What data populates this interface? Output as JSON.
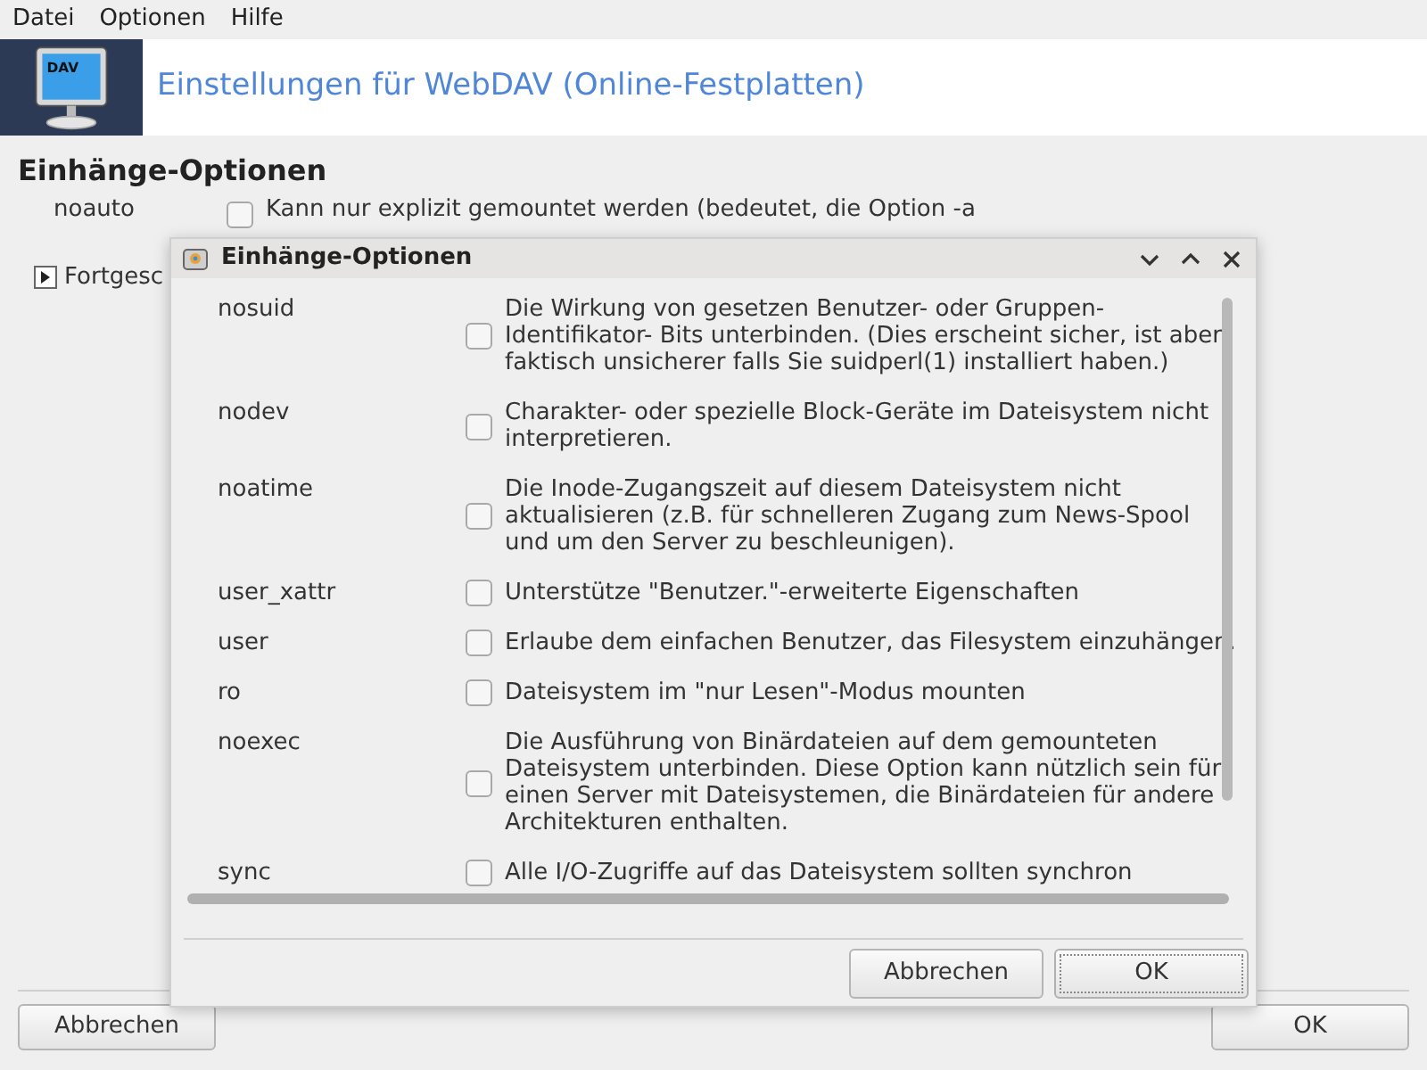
{
  "menu": [
    "Datei",
    "Optionen",
    "Hilfe"
  ],
  "header": {
    "icon_text": "DAV",
    "title": "Einstellungen für WebDAV (Online-Festplatten)"
  },
  "section_title": "Einhänge-Optionen",
  "background_option": {
    "name": "noauto",
    "checked": false,
    "text": "Kann nur explizit gemountet werden (bedeutet, die Option -a"
  },
  "advanced": {
    "label": "Fortgesc",
    "expanded": false
  },
  "buttons": [
    "Abbrechen",
    "OK"
  ],
  "dialog": {
    "title": "Einhänge-Optionen",
    "options": [
      {
        "name": "nosuid",
        "checked": false,
        "text": "Die Wirkung von gesetzen Benutzer- oder Gruppen-Identifikator- Bits unterbinden. (Dies erscheint sicher, ist aber faktisch unsicherer falls Sie suidperl(1) installiert haben.)"
      },
      {
        "name": "nodev",
        "checked": false,
        "text": "Charakter- oder spezielle Block-Geräte im Dateisystem nicht interpretieren."
      },
      {
        "name": "noatime",
        "checked": false,
        "text": "Die Inode-Zugangszeit auf diesem Dateisystem nicht aktualisieren (z.B. für schnelleren Zugang zum News-Spool und um den Server zu beschleunigen)."
      },
      {
        "name": "user_xattr",
        "checked": false,
        "text": "Unterstütze \"Benutzer.\"-erweiterte Eigenschaften"
      },
      {
        "name": "user",
        "checked": false,
        "text": "Erlaube dem einfachen Benutzer, das Filesystem einzuhängen."
      },
      {
        "name": "ro",
        "checked": false,
        "text": "Dateisystem im \"nur Lesen\"-Modus mounten"
      },
      {
        "name": "noexec",
        "checked": false,
        "text": "Die Ausführung von Binärdateien auf dem gemounteten Dateisystem unterbinden. Diese Option kann nützlich sein für einen Server mit Dateisystemen, die Binärdateien für andere Architekturen enthalten."
      },
      {
        "name": "sync",
        "checked": false,
        "text": "Alle I/O-Zugriffe auf das Dateisystem sollten synchron"
      }
    ],
    "buttons": [
      "Abbrechen",
      "OK"
    ]
  }
}
